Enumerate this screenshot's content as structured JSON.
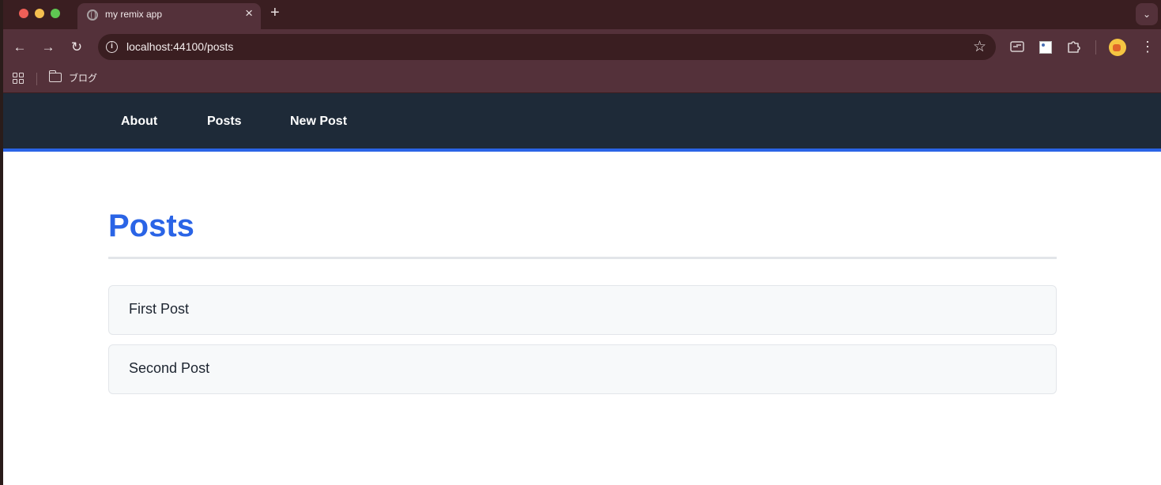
{
  "browser": {
    "tab_title": "my remix app",
    "tab_close": "×",
    "new_tab": "+",
    "tab_menu": "⌄",
    "url": "localhost:44100/posts",
    "back": "←",
    "forward": "→",
    "reload": "↻",
    "star": "☆",
    "kebab": "⋮",
    "info": "i",
    "bookmarks": [
      {
        "label": "ブログ",
        "icon": "folder-icon"
      }
    ]
  },
  "nav": {
    "links": [
      {
        "label": "About"
      },
      {
        "label": "Posts"
      },
      {
        "label": "New Post"
      }
    ]
  },
  "page": {
    "title": "Posts",
    "posts": [
      {
        "title": "First Post"
      },
      {
        "title": "Second Post"
      }
    ]
  },
  "colors": {
    "accent": "#2a64e6",
    "nav_bg": "#1e2a38",
    "browser_frame": "#54313a"
  }
}
